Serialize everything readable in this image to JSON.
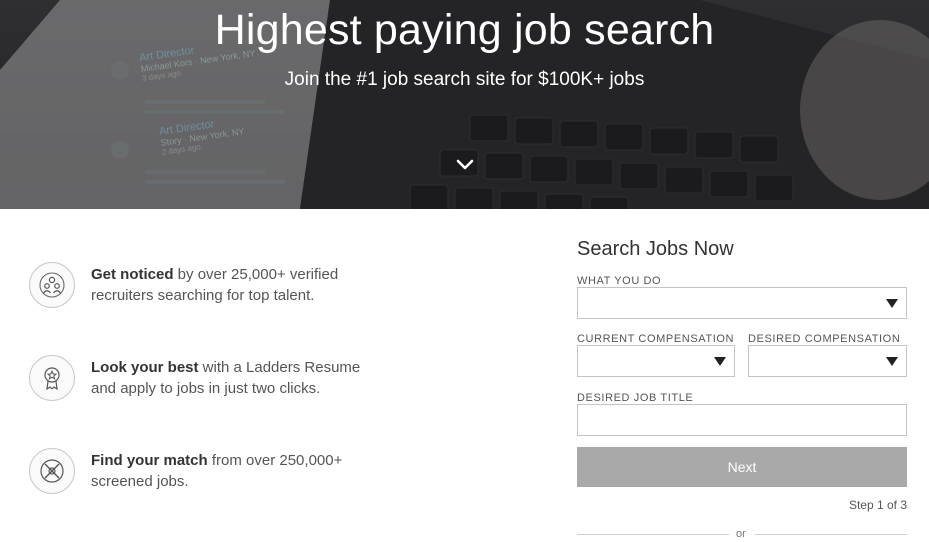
{
  "hero": {
    "title": "Highest paying job search",
    "subtitle": "Join the #1 job search site for $100K+ jobs",
    "bg_cards": [
      {
        "title": "Art Director",
        "company": "Michael Kors · New York, NY",
        "posted": "3 days ago"
      },
      {
        "title": "Art Director",
        "company": "Story · New York, NY",
        "posted": "2 days ago"
      }
    ]
  },
  "features": [
    {
      "icon": "people-icon",
      "bold": "Get noticed",
      "line1_rest": " by over 25,000+ verified",
      "line2": "recruiters searching for top talent."
    },
    {
      "icon": "award-ribbon-icon",
      "bold": "Look your best",
      "line1_rest": " with a Ladders Resume",
      "line2": "and apply to jobs in just two clicks."
    },
    {
      "icon": "match-icon",
      "bold": "Find your match",
      "line1_rest": " from over 250,000+",
      "line2": "screened jobs."
    }
  ],
  "form": {
    "title": "Search Jobs Now",
    "what_you_do_label": "WHAT YOU DO",
    "what_you_do_value": "",
    "current_comp_label": "CURRENT COMPENSATION",
    "current_comp_value": "",
    "desired_comp_label": "DESIRED COMPENSATION",
    "desired_comp_value": "",
    "desired_title_label": "DESIRED JOB TITLE",
    "desired_title_value": "",
    "next_label": "Next",
    "step_text": "Step 1 of 3",
    "or_text": "or"
  },
  "colors": {
    "button_disabled": "#a9a9a9",
    "hero_overlay": "#2f2f31",
    "text": "#333333"
  }
}
